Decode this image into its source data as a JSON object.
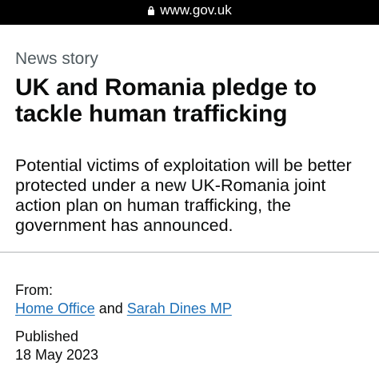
{
  "browser": {
    "url": "www.gov.uk"
  },
  "article": {
    "kicker": "News story",
    "title": "UK and Romania pledge to tackle human trafficking",
    "lede": "Potential victims of exploitation will be better protected under a new UK-Romania joint action plan on human trafficking, the government has announced."
  },
  "metadata": {
    "from_label": "From:",
    "organisation": "Home Office",
    "conjunction": "and",
    "person": "Sarah Dines MP",
    "published_label": "Published",
    "published_date": "18 May 2023"
  },
  "colors": {
    "link": "#1d70b8",
    "text": "#0b0c0c",
    "secondary_text": "#505a5f",
    "browser_bar": "#000000"
  }
}
